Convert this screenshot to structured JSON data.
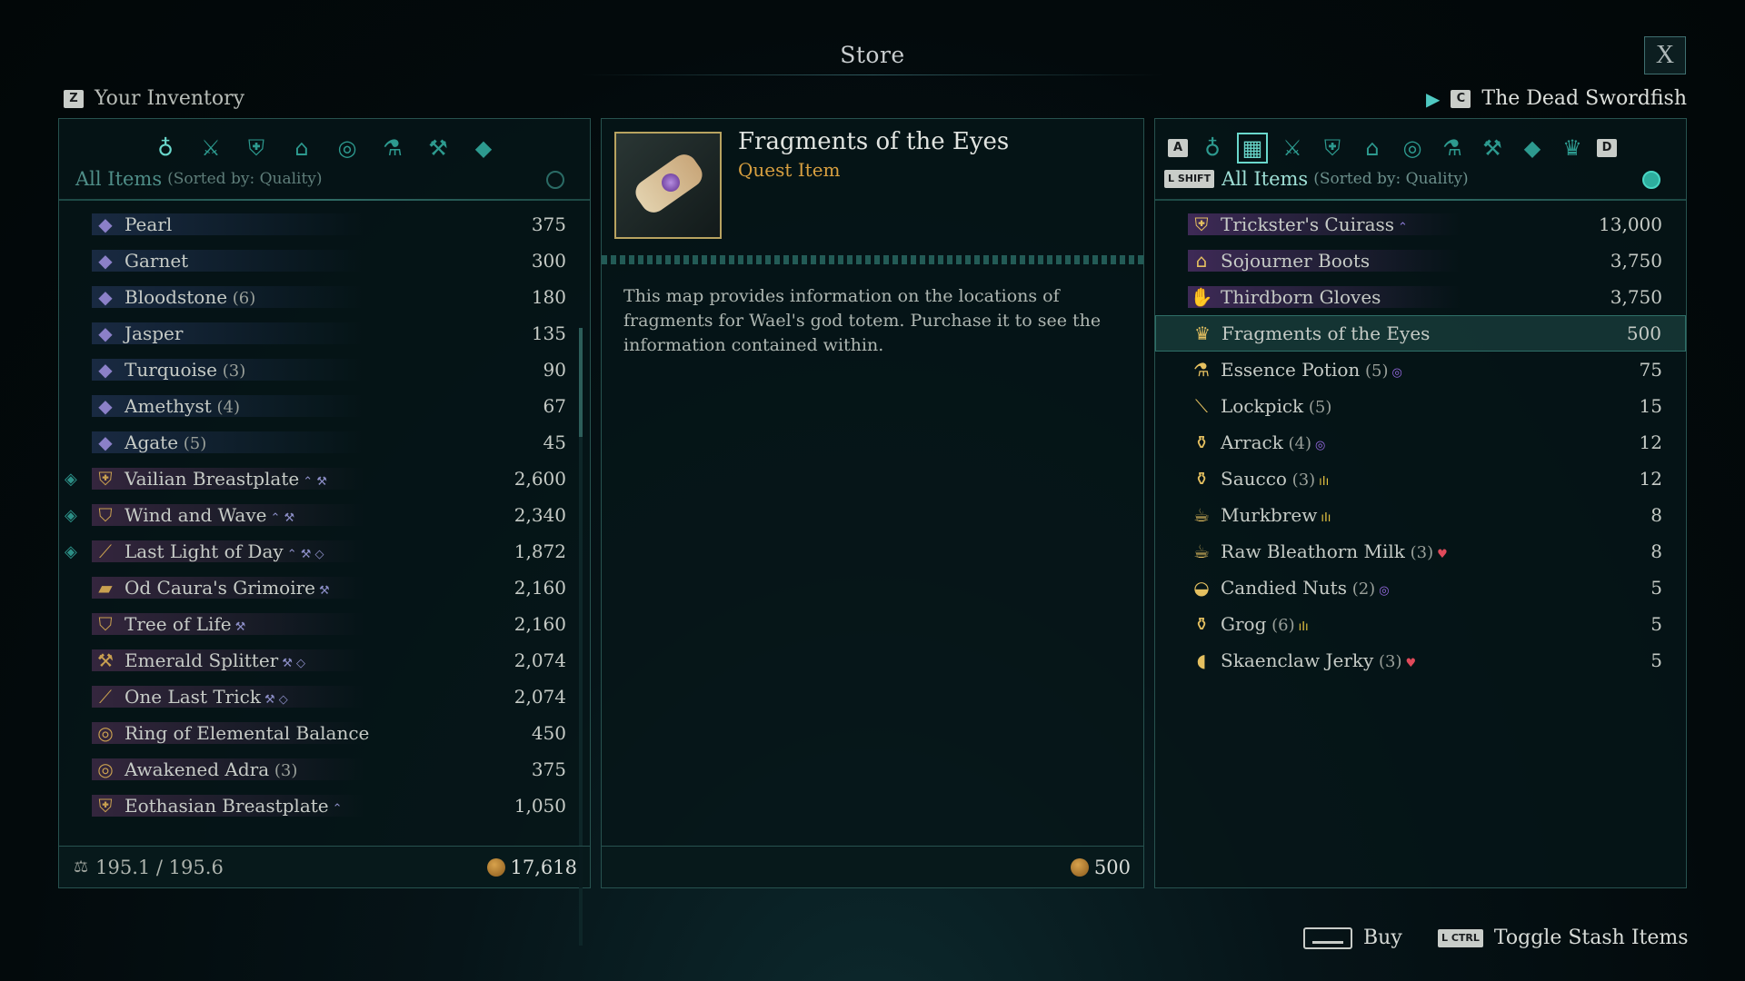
{
  "title": "Store",
  "close_label": "X",
  "inventory": {
    "key": "Z",
    "label": "Your Inventory",
    "category_icons": [
      "bag-icon",
      "swords-icon",
      "armor-icon",
      "boots-icon",
      "ring-icon",
      "potion-icon",
      "anvil-icon",
      "gem-icon"
    ],
    "filter_label": "All Items",
    "sort_label": "(Sorted by: Quality)",
    "items": [
      {
        "name": "Pearl",
        "qty": "",
        "price": "375",
        "icon": "gem",
        "mark": "",
        "tags": "",
        "color": "#8b80c8"
      },
      {
        "name": "Garnet",
        "qty": "",
        "price": "300",
        "icon": "gem",
        "mark": "",
        "tags": "",
        "color": "#8b80c8"
      },
      {
        "name": "Bloodstone",
        "qty": "(6)",
        "price": "180",
        "icon": "gem",
        "mark": "",
        "tags": "",
        "color": "#8b80c8"
      },
      {
        "name": "Jasper",
        "qty": "",
        "price": "135",
        "icon": "gem",
        "mark": "",
        "tags": "",
        "color": "#8b80c8"
      },
      {
        "name": "Turquoise",
        "qty": "(3)",
        "price": "90",
        "icon": "gem",
        "mark": "",
        "tags": "",
        "color": "#8b80c8"
      },
      {
        "name": "Amethyst",
        "qty": "(4)",
        "price": "67",
        "icon": "gem",
        "mark": "",
        "tags": "",
        "color": "#8b80c8"
      },
      {
        "name": "Agate",
        "qty": "(5)",
        "price": "45",
        "icon": "gem",
        "mark": "",
        "tags": "",
        "color": "#8b80c8"
      },
      {
        "name": "Vailian Breastplate",
        "qty": "",
        "price": "2,600",
        "icon": "armor",
        "mark": "◈",
        "tags": "⌃ ⚒",
        "color": "#c9a050"
      },
      {
        "name": "Wind and Wave",
        "qty": "",
        "price": "2,340",
        "icon": "shield",
        "mark": "◈",
        "tags": "⌃ ⚒",
        "color": "#c9a050"
      },
      {
        "name": "Last Light of Day",
        "qty": "",
        "price": "1,872",
        "icon": "sword",
        "mark": "◈",
        "tags": "⌃ ⚒ ◇",
        "color": "#c9a050"
      },
      {
        "name": "Od Caura's Grimoire",
        "qty": "",
        "price": "2,160",
        "icon": "book",
        "mark": "",
        "tags": "⚒",
        "color": "#c9a050"
      },
      {
        "name": "Tree of Life",
        "qty": "",
        "price": "2,160",
        "icon": "shield",
        "mark": "",
        "tags": "⚒",
        "color": "#c9a050"
      },
      {
        "name": "Emerald Splitter",
        "qty": "",
        "price": "2,074",
        "icon": "axe",
        "mark": "",
        "tags": "⚒ ◇",
        "color": "#c9a050"
      },
      {
        "name": "One Last Trick",
        "qty": "",
        "price": "2,074",
        "icon": "sword",
        "mark": "",
        "tags": "⚒ ◇",
        "color": "#c9a050"
      },
      {
        "name": "Ring of Elemental Balance",
        "qty": "",
        "price": "450",
        "icon": "ring",
        "mark": "",
        "tags": "",
        "color": "#c9a050"
      },
      {
        "name": "Awakened Adra",
        "qty": "(3)",
        "price": "375",
        "icon": "ring",
        "mark": "",
        "tags": "",
        "color": "#c9a050"
      },
      {
        "name": "Eothasian Breastplate",
        "qty": "",
        "price": "1,050",
        "icon": "armor",
        "mark": "",
        "tags": "⌃",
        "color": "#c9a050"
      }
    ],
    "weight": "195.1 / 195.6",
    "money": "17,618"
  },
  "detail": {
    "name": "Fragments of the Eyes",
    "type": "Quest Item",
    "description": "This map provides information on the locations of fragments for Wael's god totem. Purchase it to see the information contained within.",
    "price": "500"
  },
  "merchant": {
    "key": "C",
    "name": "The Dead Swordfish",
    "key_left": "A",
    "key_right": "D",
    "shift_key": "L SHIFT",
    "category_icons": [
      "bag-icon",
      "crate-icon",
      "swords-icon",
      "armor-icon",
      "boots-icon",
      "ring-icon",
      "potion-icon",
      "anvil-icon",
      "gem-icon",
      "crown-icon"
    ],
    "filter_label": "All Items",
    "sort_label": "(Sorted by: Quality)",
    "selected_index": 3,
    "items": [
      {
        "name": "Trickster's Cuirass",
        "qty": "",
        "price": "13,000",
        "icon": "armor",
        "tags": "⌃",
        "tagcolor": "#8d7bd8"
      },
      {
        "name": "Sojourner Boots",
        "qty": "",
        "price": "3,750",
        "icon": "boots",
        "tags": "",
        "tagcolor": "#8d7bd8"
      },
      {
        "name": "Thirdborn Gloves",
        "qty": "",
        "price": "3,750",
        "icon": "gloves",
        "tags": "",
        "tagcolor": "#8d7bd8"
      },
      {
        "name": "Fragments of the Eyes",
        "qty": "",
        "price": "500",
        "icon": "crown",
        "tags": "",
        "tagcolor": "#8d7bd8"
      },
      {
        "name": "Essence Potion",
        "qty": "(5)",
        "price": "75",
        "icon": "potion",
        "tags": "◎",
        "tagcolor": "#9a6ce6"
      },
      {
        "name": "Lockpick",
        "qty": "(5)",
        "price": "15",
        "icon": "pick",
        "tags": "",
        "tagcolor": "#8d7bd8"
      },
      {
        "name": "Arrack",
        "qty": "(4)",
        "price": "12",
        "icon": "bottle",
        "tags": "◎",
        "tagcolor": "#9a6ce6"
      },
      {
        "name": "Saucco",
        "qty": "(3)",
        "price": "12",
        "icon": "bottle",
        "tags": "ıIı",
        "tagcolor": "#e0c040"
      },
      {
        "name": "Murkbrew",
        "qty": "",
        "price": "8",
        "icon": "cup",
        "tags": "ıIı",
        "tagcolor": "#e0c040"
      },
      {
        "name": "Raw Bleathorn Milk",
        "qty": "(3)",
        "price": "8",
        "icon": "cup",
        "tags": "♥",
        "tagcolor": "#e04a5a"
      },
      {
        "name": "Candied Nuts",
        "qty": "(2)",
        "price": "5",
        "icon": "bowl",
        "tags": "◎",
        "tagcolor": "#9a6ce6"
      },
      {
        "name": "Grog",
        "qty": "(6)",
        "price": "5",
        "icon": "bottle",
        "tags": "ıIı",
        "tagcolor": "#e0c040"
      },
      {
        "name": "Skaenclaw Jerky",
        "qty": "(3)",
        "price": "5",
        "icon": "meat",
        "tags": "♥",
        "tagcolor": "#e04a5a"
      }
    ]
  },
  "hints": {
    "buy_label": "Buy",
    "toggle_key": "L CTRL",
    "toggle_label": "Toggle Stash Items"
  }
}
